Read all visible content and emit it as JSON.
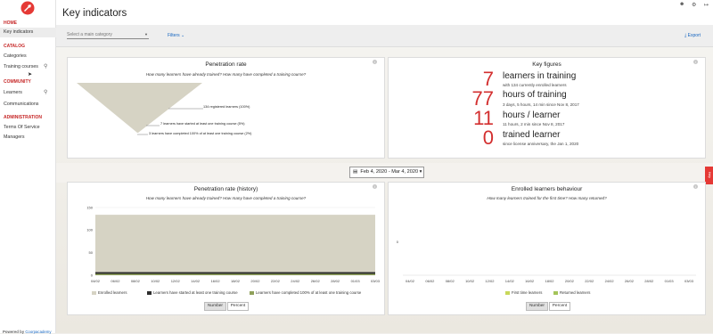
{
  "sidebar": {
    "home_header": "HOME",
    "key_indicators": "Key indicators",
    "catalog_header": "CATALOG",
    "categories": "Categories",
    "training_courses": "Training courses",
    "community_header": "COMMUNITY",
    "learners": "Learners",
    "communications": "Communications",
    "administration_header": "ADMINISTRATION",
    "terms_of_service": "Terms Of Service",
    "managers": "Managers",
    "powered_prefix": "Powered by",
    "powered_brand": "Coorpacademy"
  },
  "header": {
    "title": "Key indicators",
    "category_placeholder": "Select a main category",
    "filters_label": "Filters",
    "export_label": "Export"
  },
  "penetration": {
    "title": "Penetration rate",
    "subtitle": "How many learners have already trained? How many have completed a training course?",
    "registered": "134 registered learners (100%)",
    "started": "7 learners have started at least one training course (5%)",
    "completed": "3 learners have completed 100% of at least one training course (2%)"
  },
  "key_figures": {
    "title": "Key figures",
    "items": [
      {
        "value": "7",
        "label": "learners in training",
        "sub": "with 134 currently enrolled learners"
      },
      {
        "value": "77",
        "label": "hours of training",
        "sub": "3 days, 5 hours, 14 min since Nov 8, 2017"
      },
      {
        "value": "11",
        "label": "hours / learner",
        "sub": "11 hours, 2 min since Nov 8, 2017"
      },
      {
        "value": "0",
        "label": "trained learner",
        "sub": "since license anniversary, the Jan 1, 2020"
      }
    ]
  },
  "date_range": "Feb 4, 2020 - Mar 4, 2020",
  "history": {
    "title": "Penetration rate (history)",
    "subtitle": "How many learners have already trained? How many have completed a training course?",
    "y_ticks": [
      "150",
      "100",
      "50",
      "0"
    ],
    "x_ticks": [
      "04/02",
      "06/02",
      "08/02",
      "10/02",
      "12/02",
      "14/02",
      "16/02",
      "18/02",
      "20/02",
      "22/02",
      "24/02",
      "26/02",
      "28/02",
      "01/03",
      "03/03"
    ],
    "legend": [
      "Enrolled learners",
      "Learners have started at least one training course",
      "Learners have completed 100% of at least one training course"
    ],
    "toggle_number": "Number",
    "toggle_percent": "Percent"
  },
  "behaviour": {
    "title": "Enrolled learners behaviour",
    "subtitle": "How many learners trained for the first time? How many returned?",
    "y_tick": "0",
    "x_ticks": [
      "04/02",
      "06/02",
      "08/02",
      "10/02",
      "12/02",
      "14/02",
      "16/02",
      "18/02",
      "20/02",
      "22/02",
      "24/02",
      "26/02",
      "28/02",
      "01/03",
      "03/03"
    ],
    "legend": [
      "First time learners",
      "Returned learners"
    ],
    "toggle_number": "Number",
    "toggle_percent": "Percent"
  },
  "colors": {
    "accent": "#d32f2f",
    "link": "#1565c0",
    "enrolled": "#d6d3c4",
    "started": "#2e2e2e",
    "completed": "#8fa05a",
    "first_time": "#c8d85a",
    "returned": "#a4c45a"
  },
  "chart_data": [
    {
      "type": "area",
      "title": "Penetration rate (history)",
      "x": [
        "04/02",
        "06/02",
        "08/02",
        "10/02",
        "12/02",
        "14/02",
        "16/02",
        "18/02",
        "20/02",
        "22/02",
        "24/02",
        "26/02",
        "28/02",
        "01/03",
        "03/03"
      ],
      "ylim": [
        0,
        150
      ],
      "series": [
        {
          "name": "Enrolled learners",
          "values": [
            134,
            134,
            134,
            134,
            134,
            134,
            134,
            134,
            134,
            134,
            134,
            134,
            134,
            134,
            134
          ]
        },
        {
          "name": "Learners have started at least one training course",
          "values": [
            7,
            7,
            7,
            7,
            7,
            7,
            7,
            7,
            7,
            7,
            7,
            7,
            7,
            7,
            7
          ]
        },
        {
          "name": "Learners have completed 100% of at least one training course",
          "values": [
            3,
            3,
            3,
            3,
            3,
            3,
            3,
            3,
            3,
            3,
            3,
            3,
            3,
            3,
            3
          ]
        }
      ]
    },
    {
      "type": "bar",
      "title": "Enrolled learners behaviour",
      "x": [
        "04/02",
        "06/02",
        "08/02",
        "10/02",
        "12/02",
        "14/02",
        "16/02",
        "18/02",
        "20/02",
        "22/02",
        "24/02",
        "26/02",
        "28/02",
        "01/03",
        "03/03"
      ],
      "series": [
        {
          "name": "First time learners",
          "values": [
            0,
            0,
            0,
            0,
            0,
            0,
            0,
            0,
            0,
            0,
            0,
            0,
            0,
            0,
            0
          ]
        },
        {
          "name": "Returned learners",
          "values": [
            0,
            0,
            0,
            0,
            0,
            0,
            0,
            0,
            0,
            0,
            0,
            0,
            0,
            0,
            0
          ]
        }
      ]
    }
  ]
}
